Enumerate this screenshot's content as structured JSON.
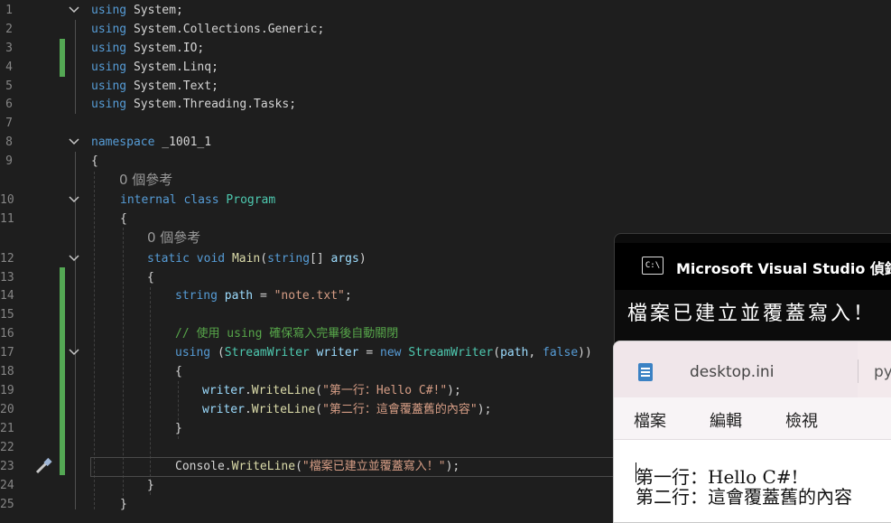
{
  "editor": {
    "lines": [
      {
        "n": "1",
        "text": "using System;"
      },
      {
        "n": "2",
        "text": "using System.Collections.Generic;"
      },
      {
        "n": "3",
        "text": "using System.IO;"
      },
      {
        "n": "4",
        "text": "using System.Linq;"
      },
      {
        "n": "5",
        "text": "using System.Text;"
      },
      {
        "n": "6",
        "text": "using System.Threading.Tasks;"
      },
      {
        "n": "7",
        "text": ""
      },
      {
        "n": "8",
        "text": "namespace _1001_1"
      },
      {
        "n": "9",
        "text": "{"
      },
      {
        "n": "10",
        "text": "internal class Program"
      },
      {
        "n": "11",
        "text": "{"
      },
      {
        "n": "12",
        "text": "static void Main(string[] args)"
      },
      {
        "n": "13",
        "text": "{"
      },
      {
        "n": "14",
        "text": "string path = \"note.txt\";"
      },
      {
        "n": "15",
        "text": ""
      },
      {
        "n": "16",
        "text": "// 使用 using 確保寫入完畢後自動關閉"
      },
      {
        "n": "17",
        "text": "using (StreamWriter writer = new StreamWriter(path, false))"
      },
      {
        "n": "18",
        "text": "{"
      },
      {
        "n": "19",
        "text": "writer.WriteLine(\"第一行：Hello C#!\");"
      },
      {
        "n": "20",
        "text": "writer.WriteLine(\"第二行：這會覆蓋舊的內容\");"
      },
      {
        "n": "21",
        "text": "}"
      },
      {
        "n": "22",
        "text": ""
      },
      {
        "n": "23",
        "text": "Console.WriteLine(\"檔案已建立並覆蓋寫入！\");"
      },
      {
        "n": "24",
        "text": "}"
      },
      {
        "n": "25",
        "text": "}"
      }
    ],
    "ref_hint_1": "0 個參考",
    "ref_hint_2": "0 個參考"
  },
  "console": {
    "title": "Microsoft Visual Studio 偵錯主",
    "output": "檔案已建立並覆蓋寫入！"
  },
  "notepad": {
    "tab_name": "desktop.ini",
    "tab2_name": "py",
    "menu": [
      "檔案",
      "編輯",
      "檢視"
    ],
    "text_line_1": "第一行：Hello C#!",
    "text_line_2": "第二行：這會覆蓋舊的內容"
  },
  "colors": {
    "editor_bg": "#1e1e1e",
    "keyword": "#569cd6",
    "type": "#4ec9b0",
    "string": "#d69d85",
    "comment": "#57a64a",
    "change_bar": "#54a854"
  }
}
